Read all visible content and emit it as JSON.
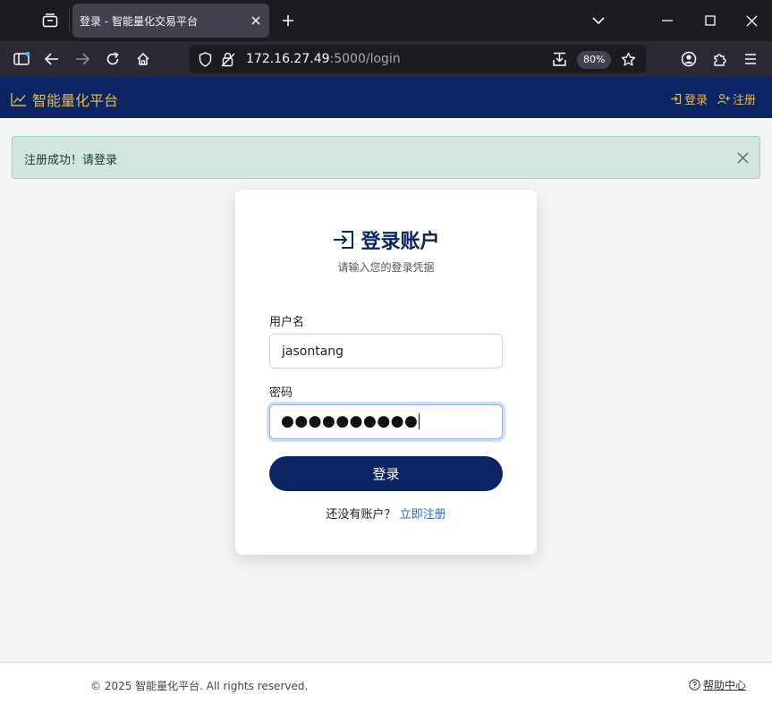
{
  "browser": {
    "tab_title": "登录 - 智能量化交易平台",
    "url_host": "172.16.27.49",
    "url_rest": ":5000/login",
    "zoom": "80%"
  },
  "header": {
    "brand": "智能量化平台",
    "login_label": "登录",
    "register_label": "注册"
  },
  "alert": {
    "message": "注册成功！请登录"
  },
  "login_card": {
    "title": "登录账户",
    "subtitle": "请输入您的登录凭据",
    "username_label": "用户名",
    "username_value": "jasontang",
    "password_label": "密码",
    "password_masked": "●●●●●●●●●●",
    "submit_label": "登录",
    "no_account_text": "还没有账户？",
    "register_link": "立即注册"
  },
  "footer": {
    "copyright": "© 2025 智能量化平台. All rights reserved.",
    "help": "帮助中心"
  },
  "colors": {
    "brand_navy": "#0b2463",
    "brand_gold": "#e8b84f",
    "alert_bg": "#d1e7dd",
    "link_blue": "#1a6fd1"
  }
}
